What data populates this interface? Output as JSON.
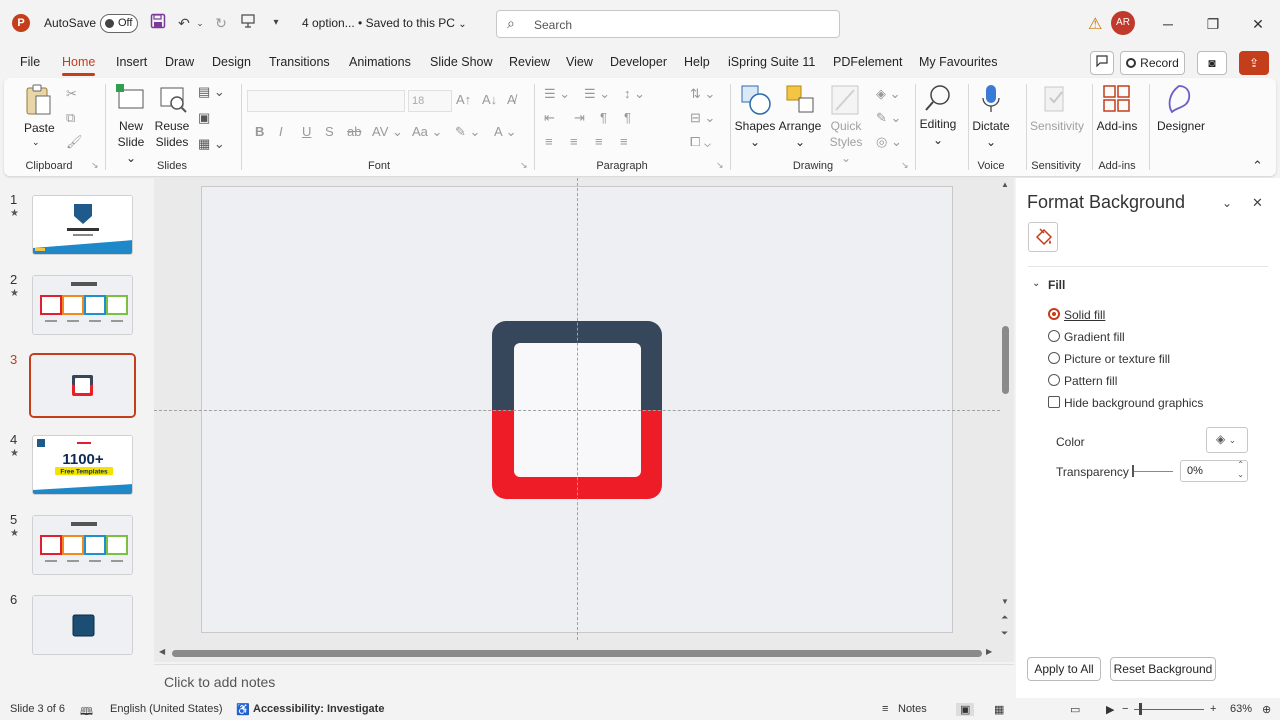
{
  "titlebar": {
    "app_logo": "P",
    "autosave_label": "AutoSave",
    "autosave_state": "Off",
    "doc_title": "4 option... • Saved to this PC",
    "search_placeholder": "Search",
    "avatar_initials": "AR"
  },
  "menu": {
    "tabs": [
      "File",
      "Home",
      "Insert",
      "Draw",
      "Design",
      "Transitions",
      "Animations",
      "Slide Show",
      "Review",
      "View",
      "Developer",
      "Help",
      "iSpring Suite 11",
      "PDFelement",
      "My Favourites"
    ],
    "active": "Home",
    "record_label": "Record"
  },
  "ribbon": {
    "clipboard": {
      "paste": "Paste",
      "group": "Clipboard"
    },
    "slides": {
      "new_slide_1": "New",
      "new_slide_2": "Slide",
      "reuse_1": "Reuse",
      "reuse_2": "Slides",
      "group": "Slides"
    },
    "font": {
      "size": "18",
      "group": "Font"
    },
    "paragraph": {
      "group": "Paragraph"
    },
    "drawing": {
      "shapes": "Shapes",
      "arrange": "Arrange",
      "quick_1": "Quick",
      "quick_2": "Styles",
      "group": "Drawing"
    },
    "editing": {
      "label": "Editing"
    },
    "voice": {
      "dictate": "Dictate",
      "group": "Voice"
    },
    "sensitivity": {
      "label": "Sensitivity",
      "group": "Sensitivity"
    },
    "addins": {
      "label": "Add-ins",
      "group": "Add-ins"
    },
    "designer": {
      "label": "Designer"
    }
  },
  "slides_panel": {
    "thumbs": [
      {
        "num": "1",
        "star": "★"
      },
      {
        "num": "2",
        "star": "★"
      },
      {
        "num": "3",
        "star": ""
      },
      {
        "num": "4",
        "star": "★"
      },
      {
        "num": "5",
        "star": "★"
      },
      {
        "num": "6",
        "star": ""
      }
    ],
    "thumb4_text": "1100+",
    "thumb4_sub": "Free Templates"
  },
  "canvas": {
    "notes_placeholder": "Click to add notes",
    "shape_top_color": "#36465b",
    "shape_bottom_color": "#ee1c27",
    "slide_bg": "#eeeff3"
  },
  "format_pane": {
    "title": "Format Background",
    "section": "Fill",
    "options": [
      "Solid fill",
      "Gradient fill",
      "Picture or texture fill",
      "Pattern fill"
    ],
    "selected": "Solid fill",
    "hide_graphics": "Hide background graphics",
    "color_label": "Color",
    "transparency_label": "Transparency",
    "transparency_value": "0%",
    "apply_all": "Apply to All",
    "reset": "Reset Background"
  },
  "statusbar": {
    "slide_info": "Slide 3 of 6",
    "language": "English (United States)",
    "accessibility": "Accessibility: Investigate",
    "notes": "Notes",
    "zoom": "63%"
  },
  "colors": {
    "accent": "#c43e1c"
  }
}
